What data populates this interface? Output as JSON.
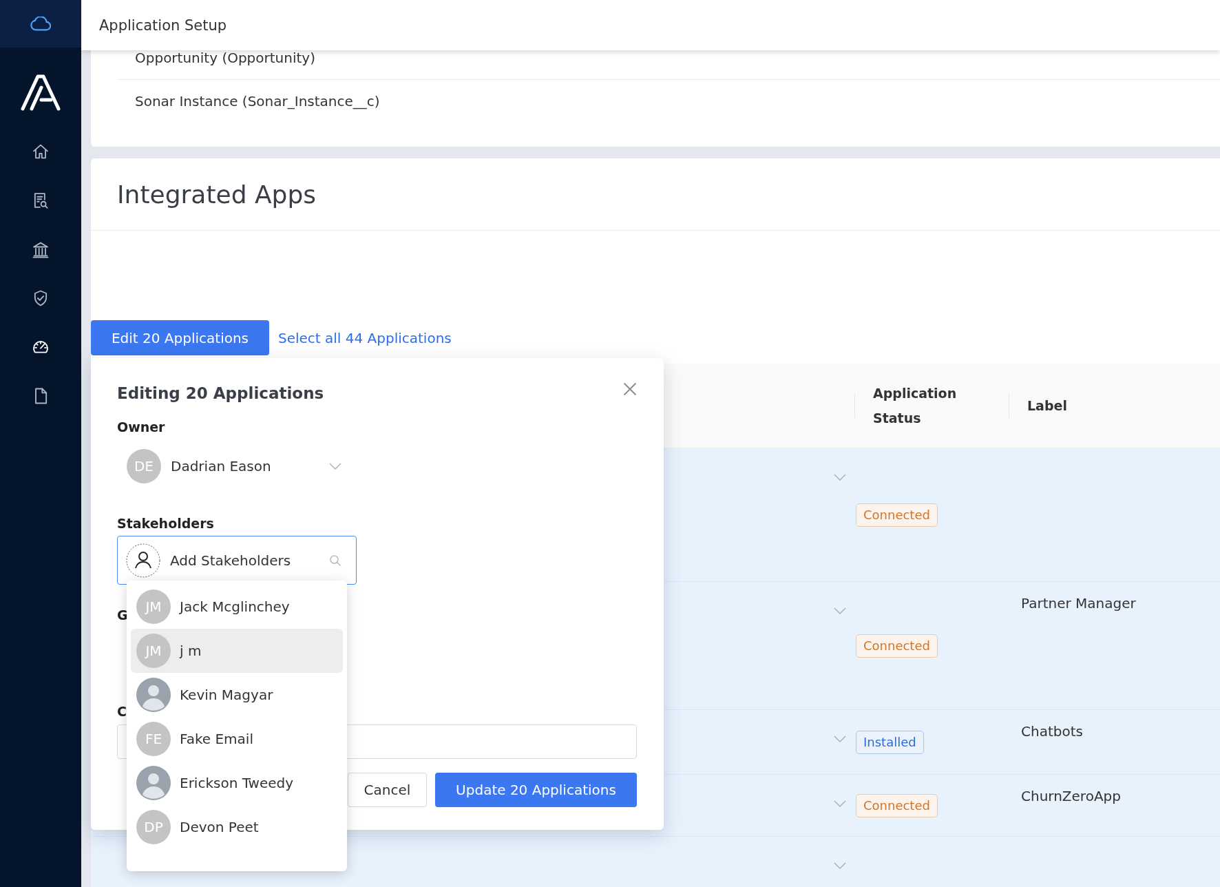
{
  "sidebar": {
    "items": [
      {
        "selected": false
      },
      {
        "selected": false
      },
      {
        "selected": false
      },
      {
        "selected": false
      },
      {
        "selected": true
      },
      {
        "selected": false
      }
    ]
  },
  "header": {
    "title": "Application Setup"
  },
  "objects_card": {
    "rows": [
      "Opportunity (Opportunity)",
      "Sonar Instance (Sonar_Instance__c)"
    ]
  },
  "integrated_apps": {
    "title": "Integrated Apps",
    "edit_button": "Edit 20 Applications",
    "select_all_link": "Select all 44 Applications",
    "table": {
      "columns": [
        {
          "label": "Application Status"
        },
        {
          "label": "Label"
        }
      ],
      "rows": [
        {
          "has_caret": true,
          "status": {
            "text": "Connected",
            "color": "#d0762c"
          }
        },
        {
          "has_caret": true,
          "status": {
            "text": "Connected",
            "color": "#d0762c"
          },
          "label": "Partner Manager"
        },
        {
          "has_caret": true,
          "status": {
            "text": "Installed",
            "color": "#2f6bd6"
          },
          "label": "Chatbots"
        },
        {
          "has_caret": true,
          "status": {
            "text": "Connected",
            "color": "#d0762c"
          },
          "label": "ChurnZeroApp"
        },
        {
          "has_caret": true
        }
      ]
    }
  },
  "edit_modal": {
    "title": "Editing 20 Applications",
    "owner": {
      "label": "Owner",
      "initials": "DE",
      "value": "Dadrian Eason"
    },
    "stakeholders": {
      "label": "Stakeholders",
      "placeholder": "Add Stakeholders",
      "expanded": true,
      "options": [
        {
          "kind": "initials",
          "initials": "JM",
          "name": "Jack Mcglinchey",
          "selected": false
        },
        {
          "kind": "initials",
          "initials": "JM",
          "name": "j m",
          "selected": true
        },
        {
          "kind": "photo",
          "name": "Kevin Magyar",
          "selected": false
        },
        {
          "kind": "initials",
          "initials": "FE",
          "name": "Fake Email",
          "selected": false
        },
        {
          "kind": "photo",
          "name": "Erickson Tweedy",
          "selected": false
        },
        {
          "kind": "initials",
          "initials": "DP",
          "name": "Devon Peet",
          "selected": false
        }
      ]
    },
    "field_3": {
      "label": "G"
    },
    "field_4": {
      "label": "C"
    },
    "buttons": [
      {
        "label": "Cancel",
        "kind": "secondary"
      },
      {
        "label": "Update 20 Applications",
        "kind": "primary"
      }
    ]
  }
}
